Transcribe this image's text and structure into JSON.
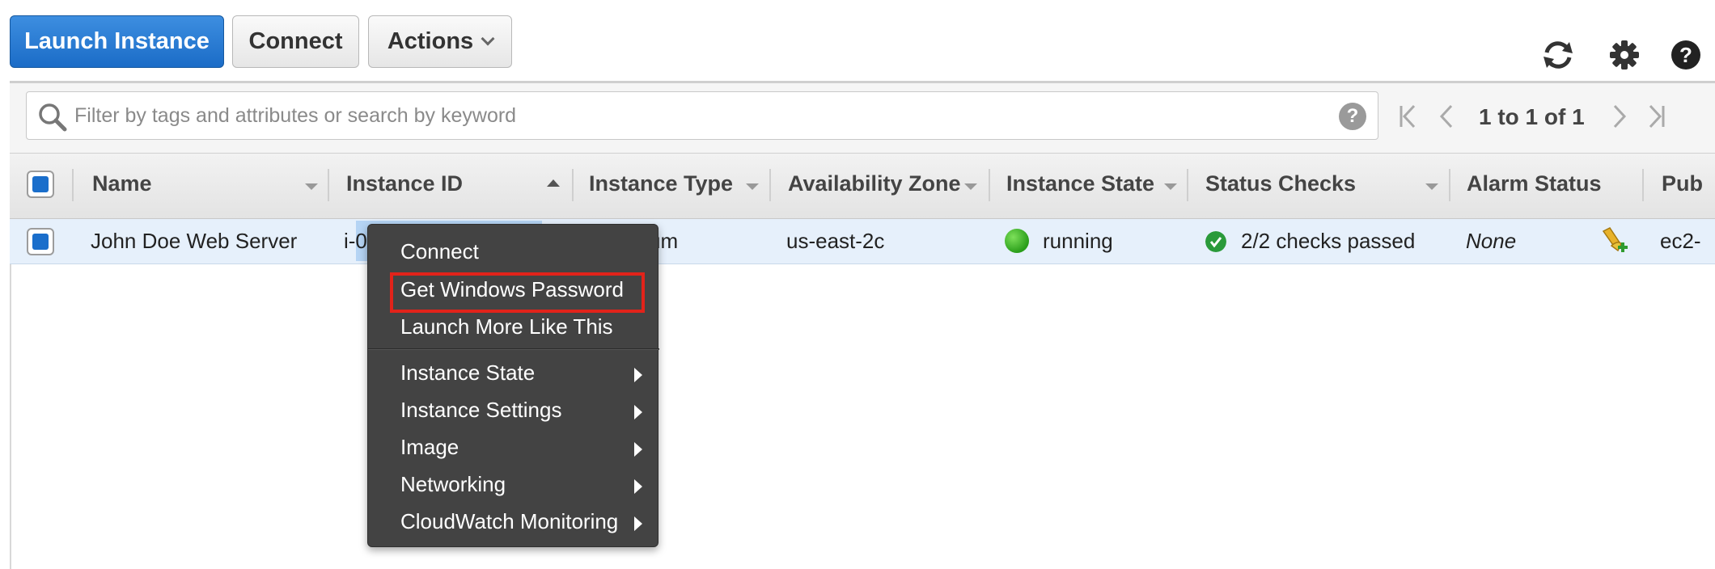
{
  "toolbar": {
    "launch_label": "Launch Instance",
    "connect_label": "Connect",
    "actions_label": "Actions",
    "icons": [
      "refresh-icon",
      "gear-icon",
      "help-icon"
    ]
  },
  "filter": {
    "placeholder": "Filter by tags and attributes or search by keyword",
    "help_glyph": "?"
  },
  "pagination": {
    "text": "1 to 1 of 1"
  },
  "table": {
    "columns": [
      "Name",
      "Instance ID",
      "Instance Type",
      "Availability Zone",
      "Instance State",
      "Status Checks",
      "Alarm Status",
      "Pub"
    ],
    "row": {
      "name": "John Doe Web Server",
      "instance_id": "i-0",
      "instance_type": "um",
      "availability_zone": "us-east-2c",
      "instance_state": "running",
      "status_checks": "2/2 checks passed",
      "alarm_status": "None",
      "public": "ec2-"
    }
  },
  "context_menu": {
    "items": [
      {
        "label": "Connect",
        "submenu": false
      },
      {
        "label": "Get Windows Password",
        "submenu": false,
        "highlighted": true
      },
      {
        "label": "Launch More Like This",
        "submenu": false
      },
      {
        "label": "Instance State",
        "submenu": true
      },
      {
        "label": "Instance Settings",
        "submenu": true
      },
      {
        "label": "Image",
        "submenu": true
      },
      {
        "label": "Networking",
        "submenu": true
      },
      {
        "label": "CloudWatch Monitoring",
        "submenu": true
      }
    ]
  },
  "colors": {
    "primary": "#1b6cc7",
    "row_selected": "#e6f0fb",
    "menu_bg": "#434343",
    "highlight_box": "#e2231a",
    "state_running": "#2a9e1a"
  }
}
